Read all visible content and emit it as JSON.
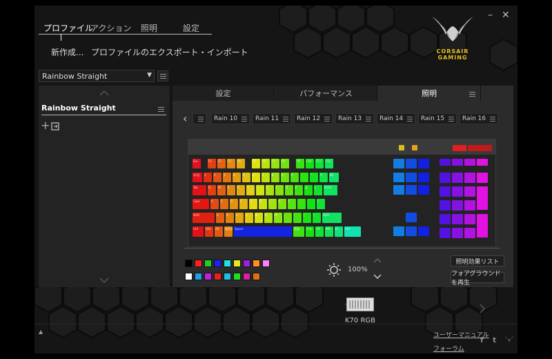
{
  "window": {
    "minimize_label": "–",
    "close_label": "✕"
  },
  "brand": {
    "line1": "CORSAIR",
    "line2": "GAMING",
    "accent": "#e8c020"
  },
  "nav": {
    "tabs": [
      "プロファイル",
      "アクション",
      "照明",
      "設定"
    ],
    "active": 0
  },
  "sub_actions": {
    "new": "新作成...",
    "export_import": "プロファイルのエクスポート・インポート"
  },
  "profile_select": {
    "value": "Rainbow Straight",
    "arrow": "▼"
  },
  "profile_list": {
    "items": [
      "Rainbow Straight"
    ],
    "add_icon": "+"
  },
  "right_tabs": {
    "tabs": [
      "設定",
      "パフォーマンス",
      "照明"
    ],
    "active": 2
  },
  "presets": {
    "items": [
      "",
      "Rain 10",
      "Rain 11",
      "Rain 12",
      "Rain 13",
      "Rain 14",
      "Rain 15",
      "Rain 16"
    ],
    "prev": "‹",
    "next": "›"
  },
  "palette": {
    "row1": [
      "#000000",
      "#ff2020",
      "#20d020",
      "#2020ff",
      "#20e0e0",
      "#e8e820",
      "#a020e0",
      "#ff9020",
      "#ff80ff"
    ],
    "row2": [
      "#ffffff",
      "#20a0e0",
      "#c020e0",
      "#e82020",
      "#20c0e0",
      "#20e020",
      "#e020a0",
      "#e07010"
    ]
  },
  "brightness": {
    "value": "100%"
  },
  "lighting_buttons": {
    "effects_list": "照明効果リスト",
    "foreground_play": "フォアグラウンドを再生"
  },
  "device": {
    "name": "K70 RGB"
  },
  "footer": {
    "user_manual": "ユーザーマニュアル",
    "forum": "フォーラム",
    "up_arrow": "▲",
    "facebook": "f",
    "twitter": "t"
  },
  "keyboard": {
    "rows": [
      [
        "Esc",
        "F1",
        "F2",
        "F3",
        "F4",
        "F5",
        "F6",
        "F7",
        "F8",
        "F9",
        "F10",
        "F11",
        "F12"
      ],
      [
        "半/全",
        "1",
        "2",
        "3",
        "4",
        "5",
        "6",
        "7",
        "8",
        "9",
        "0",
        "-",
        "^",
        "¥",
        "BS"
      ],
      [
        "Tab",
        "Q",
        "W",
        "E",
        "R",
        "T",
        "Y",
        "U",
        "I",
        "O",
        "P",
        "@",
        "[",
        "Enter"
      ],
      [
        "Caps",
        "A",
        "S",
        "D",
        "F",
        "G",
        "H",
        "J",
        "K",
        "L",
        ";",
        ":",
        "]"
      ],
      [
        "Shift",
        "Z",
        "X",
        "C",
        "V",
        "B",
        "N",
        "M",
        ",",
        ".",
        "/",
        "\\",
        "Shift"
      ],
      [
        "Ctrl",
        "Win",
        "Alt",
        "無変換",
        "Space",
        "変換",
        "かな",
        "Alt",
        "Win",
        "Fn",
        "Ctrl"
      ]
    ]
  }
}
